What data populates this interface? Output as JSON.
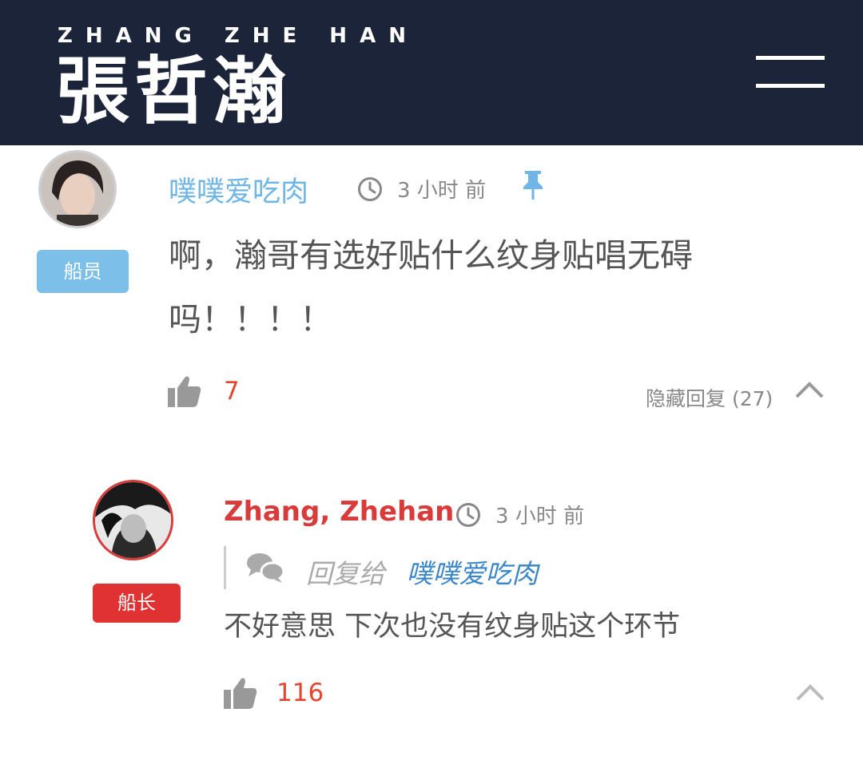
{
  "header": {
    "brand_sub": "ZHANG ZHE HAN",
    "brand_main": "張哲瀚",
    "menu_icon": "hamburger-menu-icon"
  },
  "comments": [
    {
      "username": "噗噗爱吃肉",
      "username_color": "#6fb6e6",
      "badge": "船员",
      "badge_color": "#7cc0ea",
      "time": "3 小时 前",
      "pinned_icon": "pin-icon",
      "text": "啊，瀚哥有选好贴什么纹身贴唱无碍吗！！！！",
      "likes": "7",
      "replies_toggle": "隐藏回复 (27)"
    },
    {
      "username": "Zhang, Zhehan",
      "username_color": "#d93a3a",
      "badge": "船长",
      "badge_color": "#e03232",
      "time": "3 小时 前",
      "reply_prefix": "回复给",
      "reply_to": "噗噗爱吃肉",
      "text": "不好意思 下次也没有纹身贴这个环节",
      "likes": "116"
    }
  ],
  "colors": {
    "header_bg": "#1b2438",
    "like_count": "#e5452f",
    "reply_link": "#3a86c6"
  }
}
